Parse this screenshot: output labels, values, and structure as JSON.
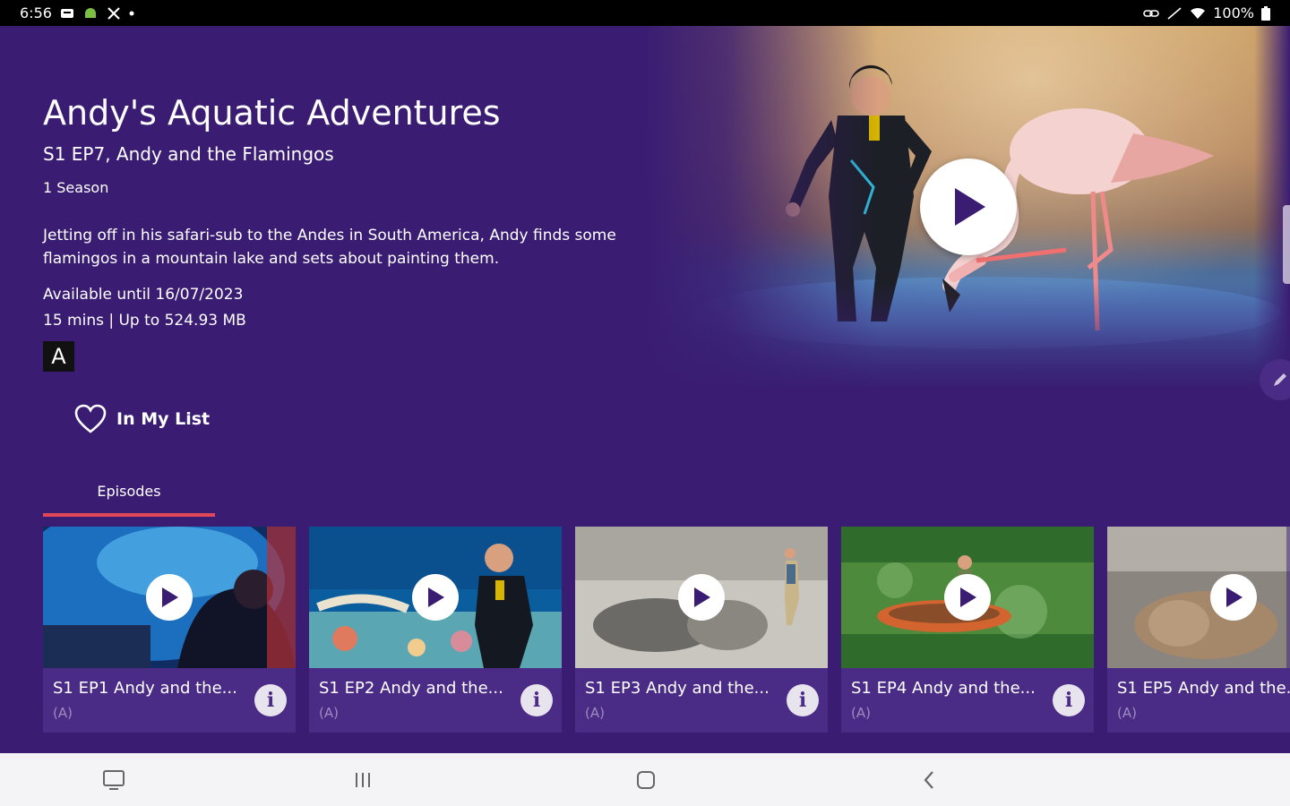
{
  "status_bar": {
    "time": "6:56",
    "battery": "100%"
  },
  "show": {
    "title": "Andy's Aquatic Adventures",
    "episode": "S1 EP7, Andy and the Flamingos",
    "seasons": "1 Season",
    "description": "Jetting off in his safari-sub to the Andes in South America, Andy finds some flamingos in a mountain lake and sets about painting them.",
    "availability": "Available until 16/07/2023",
    "meta": "15 mins | Up to 524.93 MB",
    "rating": "A"
  },
  "actions": {
    "my_list_label": "In My List"
  },
  "tabs": [
    {
      "label": "Episodes",
      "active": true
    }
  ],
  "episodes": [
    {
      "title": "S1 EP1 Andy and the...",
      "rating": "(A)"
    },
    {
      "title": "S1 EP2 Andy and the...",
      "rating": "(A)"
    },
    {
      "title": "S1 EP3 Andy and the...",
      "rating": "(A)"
    },
    {
      "title": "S1 EP4 Andy and the...",
      "rating": "(A)"
    },
    {
      "title": "S1 EP5 Andy and the...",
      "rating": "(A)"
    }
  ],
  "colors": {
    "background": "#3a1d73",
    "card": "#4a2b86",
    "tab_underline": "#e0485a",
    "nav_bar": "#f4f3f6"
  },
  "icons": {
    "play": "play-icon",
    "heart": "heart-icon",
    "info": "info-icon",
    "edit": "pencil-icon"
  }
}
